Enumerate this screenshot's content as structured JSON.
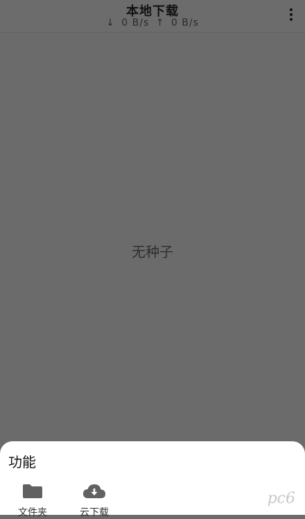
{
  "header": {
    "title": "本地下载",
    "down_arrow": "↓",
    "down_speed": "0 B/s",
    "up_arrow": "↑",
    "up_speed": "0 B/s",
    "menu_icon": "more-vert-icon"
  },
  "main": {
    "empty_text": "无种子"
  },
  "sheet": {
    "title": "功能",
    "actions": [
      {
        "icon": "folder-icon",
        "label": "文件夹"
      },
      {
        "icon": "cloud-download-icon",
        "label": "云下载"
      }
    ]
  },
  "watermark": "pc6"
}
